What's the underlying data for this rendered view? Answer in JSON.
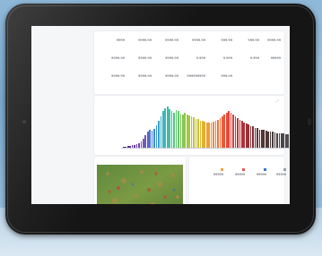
{
  "metrics": {
    "title": "",
    "rows": [
      [
        {
          "label": "",
          "value": "9999"
        },
        {
          "label": "",
          "value": "9999.99"
        },
        {
          "label": "",
          "value": "9999.99"
        },
        {
          "label": "",
          "value": "9999.99"
        },
        {
          "label": "",
          "value": "999.99"
        },
        {
          "label": "",
          "value": "999.99"
        },
        {
          "label": "",
          "value": "9999.99"
        }
      ],
      [
        {
          "label": "",
          "value": "9999.99"
        },
        {
          "label": "",
          "value": "9999.99"
        },
        {
          "label": "",
          "value": "9999.99"
        },
        {
          "label": "",
          "value": "9.999"
        },
        {
          "label": "",
          "value": "9.999"
        },
        {
          "label": "",
          "value": "9.999"
        },
        {
          "label": "",
          "value": "99999"
        }
      ],
      [
        {
          "label": "",
          "value": "9999.99"
        },
        {
          "label": "",
          "value": "9999.99"
        },
        {
          "label": "",
          "value": "9999.99"
        },
        {
          "label": "",
          "value": "999999999"
        },
        {
          "label": "",
          "value": "999.99"
        }
      ]
    ]
  },
  "spectrum": {
    "title": "",
    "chart_data": {
      "type": "bar",
      "values": [
        2,
        2,
        3,
        3,
        4,
        5,
        6,
        8,
        11,
        15,
        20,
        26,
        30,
        28,
        31,
        37,
        44,
        52,
        60,
        65,
        68,
        64,
        60,
        58,
        62,
        60,
        56,
        54,
        57,
        55,
        53,
        52,
        50,
        48,
        47,
        45,
        44,
        43,
        42,
        42,
        41,
        43,
        44,
        46,
        49,
        52,
        55,
        58,
        60,
        58,
        55,
        52,
        49,
        46,
        44,
        42,
        40,
        38,
        36,
        35,
        33,
        32,
        30,
        30,
        29,
        28,
        27,
        26,
        26,
        25,
        24,
        24,
        23,
        23,
        22,
        22,
        21,
        21,
        22,
        23,
        24,
        25,
        25,
        24,
        23,
        22,
        21,
        20,
        20,
        21
      ],
      "colors": [
        "#5a2d8a",
        "#5a2d8a",
        "#5b2f91",
        "#5e3296",
        "#60359b",
        "#6238a0",
        "#6a3ea8",
        "#7443b0",
        "#7c4ab8",
        "#7f52bf",
        "#6b5bc4",
        "#5566c8",
        "#4a73cc",
        "#3f80d0",
        "#3a8dd2",
        "#3a98d2",
        "#3aa2cf",
        "#3aabca",
        "#3bb3c3",
        "#3db8b8",
        "#40bcaa",
        "#45be9c",
        "#4cc08e",
        "#55c280",
        "#5fc472",
        "#6ac567",
        "#76c65d",
        "#83c754",
        "#90c74c",
        "#9dc745",
        "#aac73f",
        "#b6c63a",
        "#c1c437",
        "#cbc135",
        "#d3bd34",
        "#dab834",
        "#e0b234",
        "#e5ab35",
        "#e9a336",
        "#ec9b37",
        "#ee9238",
        "#ef8839",
        "#ef7e39",
        "#ef733a",
        "#ee693a",
        "#ec5f3a",
        "#ea563a",
        "#e74e3a",
        "#e3473a",
        "#de413a",
        "#d83c3a",
        "#d1383a",
        "#c9353a",
        "#c0333a",
        "#b5323a",
        "#aa3139",
        "#9e3138",
        "#923137",
        "#863136",
        "#7a3135",
        "#6f3134",
        "#653233",
        "#5c3332",
        "#553432",
        "#503633",
        "#4d3835",
        "#4b3a37",
        "#4a3c3a",
        "#4a3e3d",
        "#4a4040",
        "#4a4243",
        "#4b4446",
        "#4c4649",
        "#4d484c",
        "#4e4a4f",
        "#4f4c52",
        "#504e55",
        "#515058",
        "#52525b",
        "#53545e",
        "#545661",
        "#555864",
        "#565a67",
        "#575c6a",
        "#585e6d",
        "#596070",
        "#5a6273",
        "#5b6476",
        "#5c6679",
        "#5d687c"
      ],
      "xlabel": ""
    }
  },
  "image_panel": {
    "title": ""
  },
  "counts": {
    "title": "",
    "badge": "",
    "items": [
      {
        "label": "",
        "value": "99999",
        "color": "#f2a33a"
      },
      {
        "label": "",
        "value": "99999",
        "color": "#e85a5a"
      },
      {
        "label": "",
        "value": "99999",
        "color": "#3a78d6"
      },
      {
        "label": "",
        "value": "99999",
        "color": "#9aa0a8"
      }
    ]
  },
  "results": [
    {
      "name": "",
      "pct": "",
      "status": ""
    },
    {
      "name": "",
      "pct": "",
      "status": ""
    }
  ]
}
